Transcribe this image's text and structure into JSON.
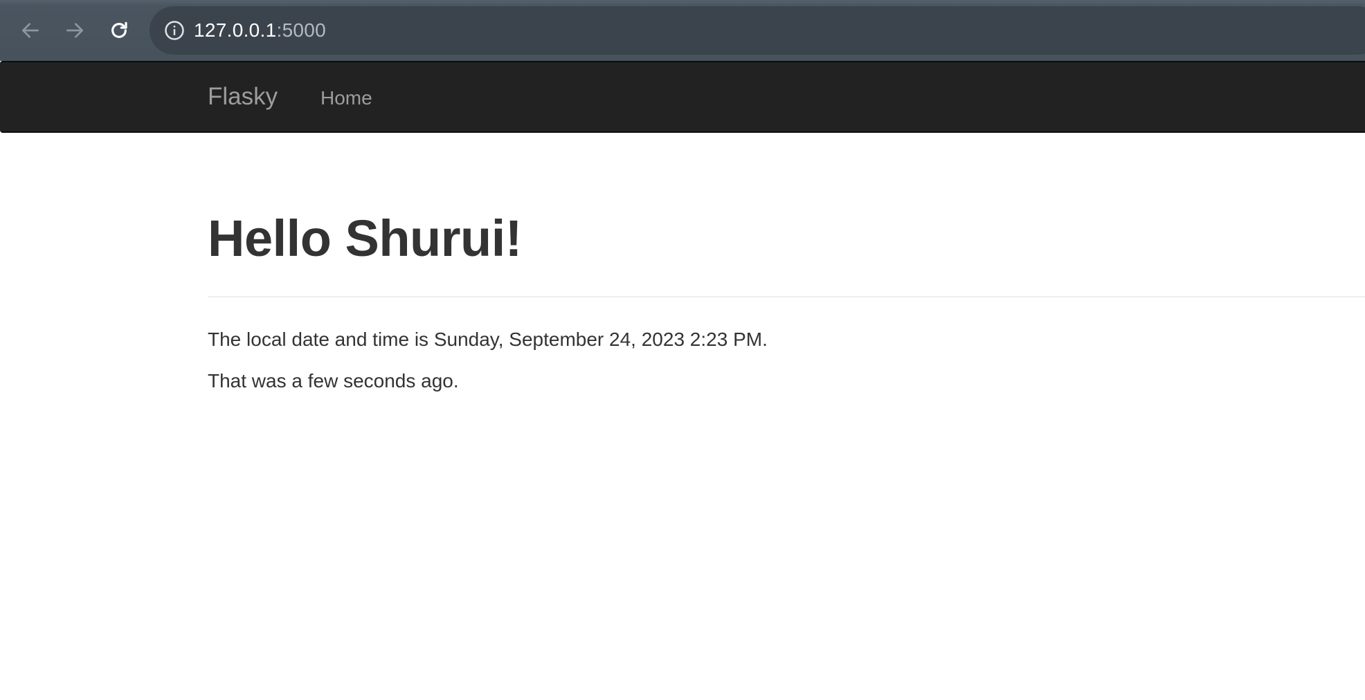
{
  "browser": {
    "url_host": "127.0.0.1",
    "url_port": ":5000"
  },
  "navbar": {
    "brand": "Flasky",
    "links": [
      "Home"
    ]
  },
  "main": {
    "heading": "Hello Shurui!",
    "datetime_text": "The local date and time is Sunday, September 24, 2023 2:23 PM.",
    "relative_text": "That was a few seconds ago."
  },
  "icons": {
    "back": "arrow-left-icon",
    "forward": "arrow-right-icon",
    "reload": "reload-icon",
    "site_info": "info-icon"
  },
  "colors": {
    "toolbar": "#47525c",
    "address_bar": "#3b444c",
    "navbar": "#222222",
    "nav_text": "#9d9d9d",
    "body_text": "#333333"
  }
}
